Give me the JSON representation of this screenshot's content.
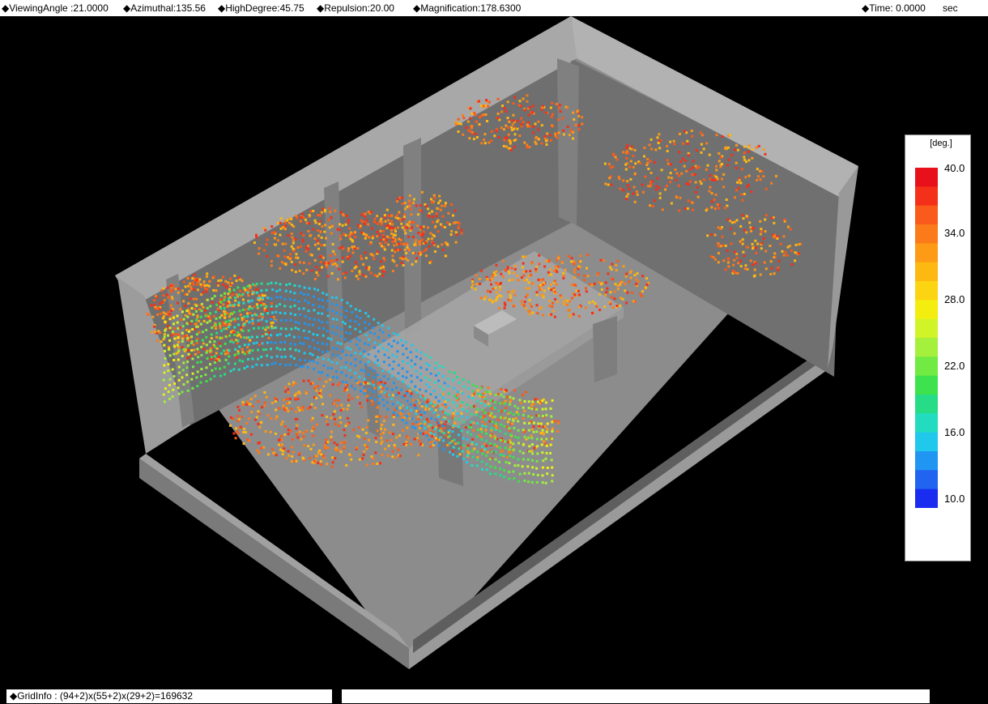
{
  "header": {
    "viewing_angle": "◆ViewingAngle :21.0000",
    "azimuthal": "◆Azimuthal:135.56",
    "high_degree": "◆HighDegree:45.75",
    "repulsion": "◆Repulsion:20.00",
    "magnification": "◆Magnification:178.6300",
    "time": "◆Time: 0.0000",
    "time_unit": "sec"
  },
  "legend": {
    "unit": "[deg.]",
    "ticks": [
      "40.0",
      "34.0",
      "28.0",
      "22.0",
      "16.0",
      "10.0"
    ],
    "colors": [
      "#e8101a",
      "#f5301a",
      "#fa5a1a",
      "#fb7a1a",
      "#fd9a16",
      "#fdb812",
      "#fdd412",
      "#f4ee10",
      "#d0f428",
      "#a4f03c",
      "#72ea44",
      "#3ee24c",
      "#26dc86",
      "#22dcc0",
      "#20c8ec",
      "#2096f2",
      "#2064f0",
      "#1a2cf0"
    ]
  },
  "footer": {
    "grid_info": "◆GridInfo : (94+2)x(55+2)x(29+2)=169632",
    "message": ""
  }
}
